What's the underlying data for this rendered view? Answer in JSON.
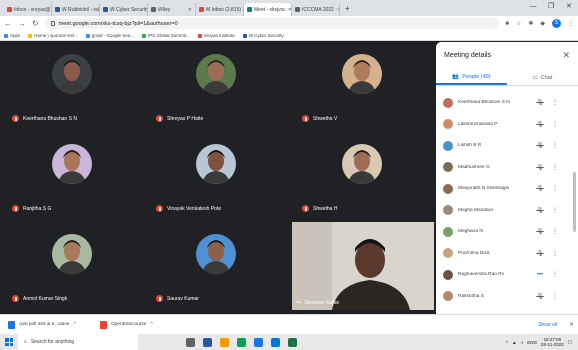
{
  "browser": {
    "tabs": [
      {
        "label": "Inbox - sreyas@...",
        "color": "#ea4335"
      },
      {
        "label": "W Rubbishtl - raley",
        "color": "#2b579a"
      },
      {
        "label": "W Cyber Security",
        "color": "#2b579a"
      },
      {
        "label": "Wiley",
        "color": "#5f6368"
      },
      {
        "label": "M Inbox (2,815) - dmk",
        "color": "#ea4335"
      },
      {
        "label": "Meet - xksjvsc",
        "color": "#00897b"
      },
      {
        "label": "ICCCMA 2022 - Co",
        "color": "#5f6368"
      }
    ],
    "new_tab": "+",
    "url": "meet.google.com/xks-tcsq-bjz?pli=1&authuser=0",
    "bookmarks": [
      {
        "label": "Apps",
        "color": "#4285f4"
      },
      {
        "label": "Home | sponsor-Kel...",
        "color": "#fbbc04"
      },
      {
        "label": "gmail - Google Sea...",
        "color": "#4285f4"
      },
      {
        "label": "IPS Global Summit...",
        "color": "#34a853"
      },
      {
        "label": "Sreyas Institute",
        "color": "#ea4335"
      },
      {
        "label": "W Cyber Security",
        "color": "#2b579a"
      }
    ],
    "window_controls": [
      "—",
      "❐",
      "✕"
    ]
  },
  "meet": {
    "tiles": [
      {
        "name": "Keerthana Bhushan S N",
        "bg": "#3c4043",
        "skin": "#8a5a48",
        "hair": "#1b1b1b"
      },
      {
        "name": "Shreyas P Hatte",
        "bg": "#5d7a4c",
        "skin": "#9c6b53",
        "hair": "#222222"
      },
      {
        "name": "Shwetha V",
        "bg": "#d5b28e",
        "skin": "#b07a5e",
        "hair": "#2a1f1a"
      },
      {
        "name": "Ranjitha S G",
        "bg": "#c9b6d9",
        "skin": "#a8765b",
        "hair": "#1a1a1a"
      },
      {
        "name": "Vinayak Venkatesh Pote",
        "bg": "#b8c7d6",
        "skin": "#7d5240",
        "hair": "#111111"
      },
      {
        "name": "Shwetha H",
        "bg": "#d8c8b4",
        "skin": "#9d6c55",
        "hair": "#201812"
      },
      {
        "name": "Anmol Kumar Singh",
        "bg": "#a9b8a0",
        "skin": "#a77a5e",
        "hair": "#1e1e1e"
      },
      {
        "name": "Saurav Kumar",
        "bg": "#4f8fd6",
        "skin": "#8f5e47",
        "hair": "#151515"
      }
    ],
    "presenter_name": "Swaroop Yadav"
  },
  "panel": {
    "title": "Meeting details",
    "close": "✕",
    "tab_people": "People (49)",
    "tab_chat": "Chat",
    "participants": [
      {
        "name": "Keerthana Bhushan S N",
        "color": "#c0705a"
      },
      {
        "name": "Lakshmimanasa P",
        "color": "#d08a6a"
      },
      {
        "name": "Likhith B R",
        "color": "#4a90c8"
      },
      {
        "name": "Madhushree G",
        "color": "#7a6a55"
      },
      {
        "name": "Manjunath N Sheshagiri",
        "color": "#8b6b52"
      },
      {
        "name": "Megha Mandara",
        "color": "#9d8b7c"
      },
      {
        "name": "Meghana N",
        "color": "#7c9b68"
      },
      {
        "name": "Poornima Dixit",
        "color": "#c7a27a"
      },
      {
        "name": "Raghavendra Rao Rv",
        "color": "#6b5343"
      },
      {
        "name": "Rakshitha S",
        "color": "#b5876b"
      }
    ]
  },
  "downloads": {
    "items": [
      {
        "label": "cpsi poll 484 & 5...wave",
        "color": "#1a73e8"
      },
      {
        "label": "OpenEdxCourse",
        "color": "#ea4335"
      }
    ],
    "show_all": "Show all"
  },
  "taskbar": {
    "search_placeholder": "Search for anything",
    "apps": [
      "#5f6368",
      "#2b579a",
      "#f29900",
      "#0f9d58",
      "#1a73e8",
      "#0078d4",
      "#217346"
    ],
    "lang": "ENG",
    "time": "18:27:00",
    "date": "28-11-2022"
  }
}
